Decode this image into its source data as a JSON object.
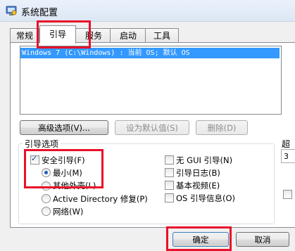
{
  "window": {
    "title": "系统配置"
  },
  "tabs": [
    {
      "label": "常规"
    },
    {
      "label": "引导"
    },
    {
      "label": "服务"
    },
    {
      "label": "启动"
    },
    {
      "label": "工具"
    }
  ],
  "boot_list": {
    "entries": [
      "Windows 7 (C:\\Windows) : 当前 OS; 默认 OS"
    ]
  },
  "buttons": {
    "advanced": "高级选项(V)...",
    "set_default": "设为默认值(S)",
    "delete": "删除(D)",
    "ok": "确定",
    "cancel": "取消"
  },
  "boot_options": {
    "group_label": "引导选项",
    "safe_boot": {
      "label": "安全引导(F)",
      "checked": true
    },
    "minimal": {
      "label": "最小(M)",
      "selected": true
    },
    "alternate_shell": {
      "label": "其他外壳(L)"
    },
    "ad_repair": {
      "label": "Active Directory 修复(P)"
    },
    "network": {
      "label": "网络(W)"
    },
    "no_gui": {
      "label": "无 GUI 引导(N)",
      "checked": false
    },
    "boot_log": {
      "label": "引导日志(B)",
      "checked": false
    },
    "base_video": {
      "label": "基本视频(E)",
      "checked": false
    },
    "os_boot_info": {
      "label": "OS 引导信息(O)",
      "checked": false
    }
  },
  "timeout": {
    "label": "超",
    "value": "3"
  },
  "colors": {
    "selection": "#3399ff",
    "highlight": "#e8102a"
  }
}
